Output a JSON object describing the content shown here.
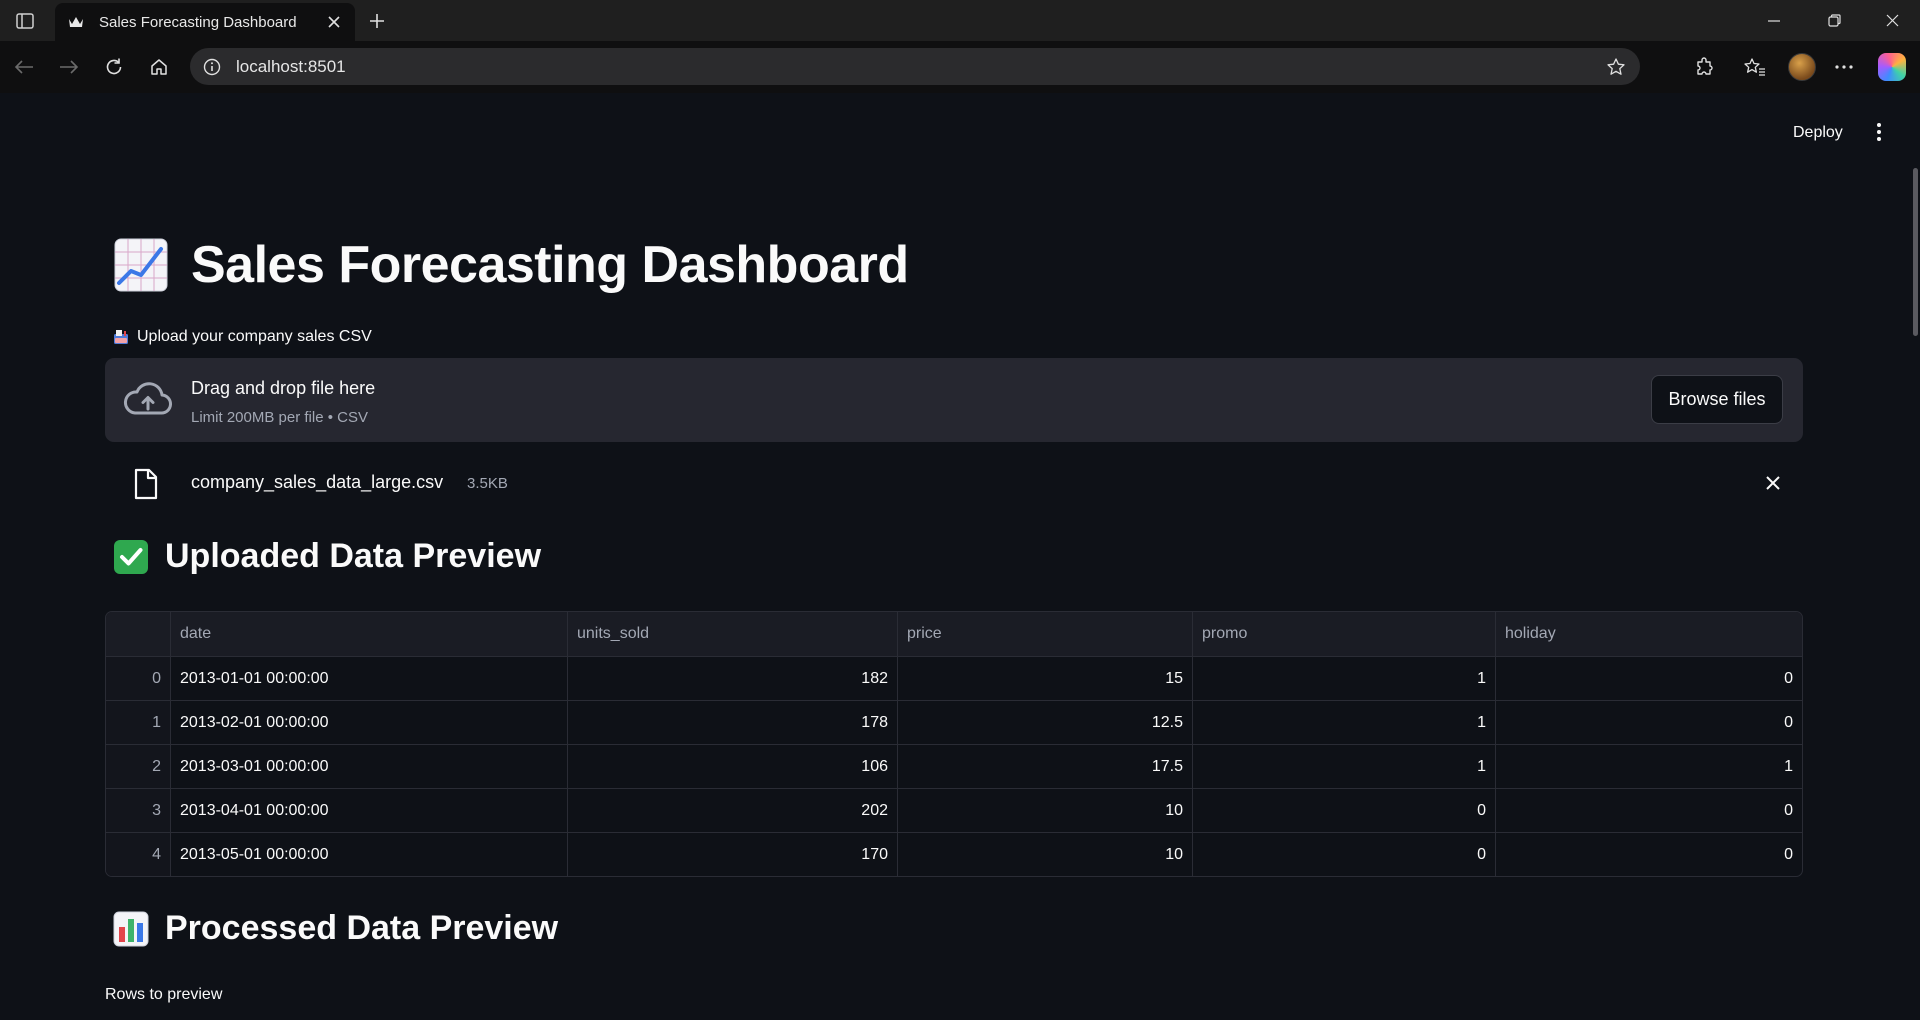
{
  "browser": {
    "tab_title": "Sales Forecasting Dashboard",
    "url": "localhost:8501"
  },
  "app": {
    "deploy_label": "Deploy",
    "title": "Sales Forecasting Dashboard",
    "title_icon": "chart-increasing-emoji",
    "uploader": {
      "label": "Upload your company sales CSV",
      "label_icon": "mailbox-emoji",
      "drop_title": "Drag and drop file here",
      "drop_subtitle": "Limit 200MB per file • CSV",
      "browse_label": "Browse files",
      "file_name": "company_sales_data_large.csv",
      "file_size": "3.5KB"
    },
    "uploaded_section": {
      "title": "Uploaded Data Preview",
      "icon": "check-mark-emoji",
      "columns": [
        "",
        "date",
        "units_sold",
        "price",
        "promo",
        "holiday"
      ],
      "rows": [
        [
          "0",
          "2013-01-01 00:00:00",
          "182",
          "15",
          "1",
          "0"
        ],
        [
          "1",
          "2013-02-01 00:00:00",
          "178",
          "12.5",
          "1",
          "0"
        ],
        [
          "2",
          "2013-03-01 00:00:00",
          "106",
          "17.5",
          "1",
          "1"
        ],
        [
          "3",
          "2013-04-01 00:00:00",
          "202",
          "10",
          "0",
          "0"
        ],
        [
          "4",
          "2013-05-01 00:00:00",
          "170",
          "10",
          "0",
          "0"
        ]
      ]
    },
    "processed_section": {
      "title": "Processed Data Preview",
      "icon": "bar-chart-emoji",
      "rows_label": "Rows to preview"
    }
  },
  "colors": {
    "background": "#0e1117",
    "secondary_background": "#262730",
    "text": "#fafafa",
    "muted_text": "#a3a8b4"
  }
}
